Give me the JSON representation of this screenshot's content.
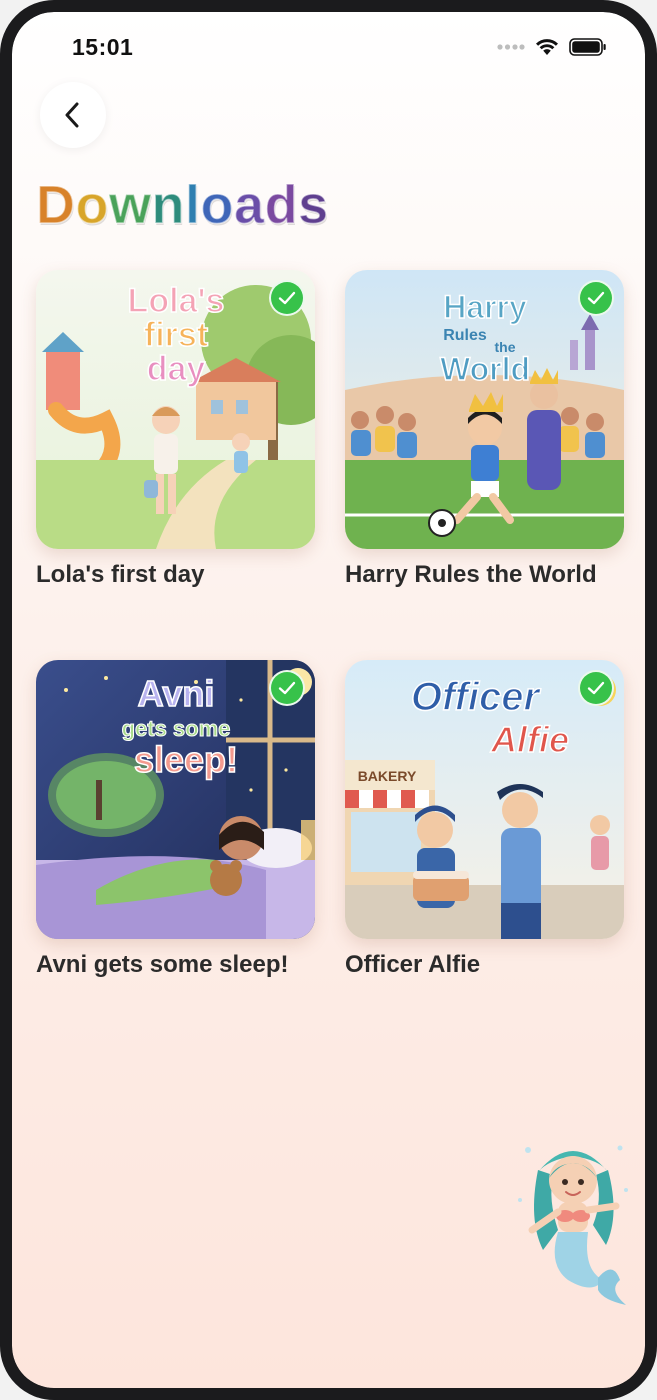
{
  "status_bar": {
    "time": "15:01",
    "icons": [
      "cellular-dots-icon",
      "wifi-icon",
      "battery-icon"
    ]
  },
  "header": {
    "back_icon": "chevron-left-icon",
    "title_letters": [
      {
        "char": "D",
        "color": "#d8822a"
      },
      {
        "char": "o",
        "color": "#d8a52a"
      },
      {
        "char": "w",
        "color": "#4aa25a"
      },
      {
        "char": "n",
        "color": "#2e8c7c"
      },
      {
        "char": "l",
        "color": "#2f7fb0"
      },
      {
        "char": "o",
        "color": "#3f66b8"
      },
      {
        "char": "a",
        "color": "#6a4ea8"
      },
      {
        "char": "d",
        "color": "#7b4aa0"
      },
      {
        "char": "s",
        "color": "#5f3f8f"
      }
    ]
  },
  "books": [
    {
      "title": "Lola's first day",
      "cover_text": [
        "Lola's",
        "first",
        "day"
      ],
      "downloaded": true,
      "palette": [
        "#e9f4df",
        "#f7d7c4",
        "#8cc26a"
      ]
    },
    {
      "title": "Harry Rules the World",
      "cover_text": [
        "Harry",
        "Rules",
        "the",
        "World"
      ],
      "downloaded": true,
      "palette": [
        "#cfe8f7",
        "#f5d27a",
        "#5fa84a"
      ]
    },
    {
      "title": "Avni gets some sleep!",
      "cover_text": [
        "Avni",
        "gets some",
        "sleep!"
      ],
      "downloaded": true,
      "palette": [
        "#2e3d73",
        "#8f7fc7",
        "#7cbf6a"
      ]
    },
    {
      "title": "Officer Alfie",
      "cover_text": [
        "Officer",
        "Alfie"
      ],
      "sign_text": "BAKERY",
      "downloaded": true,
      "palette": [
        "#d8ecf8",
        "#f6d38b",
        "#3f6ab0"
      ]
    }
  ],
  "colors": {
    "check": "#37c24a",
    "title_text": "#2b2b2b"
  },
  "mascot_icon": "mermaid-mascot-icon"
}
